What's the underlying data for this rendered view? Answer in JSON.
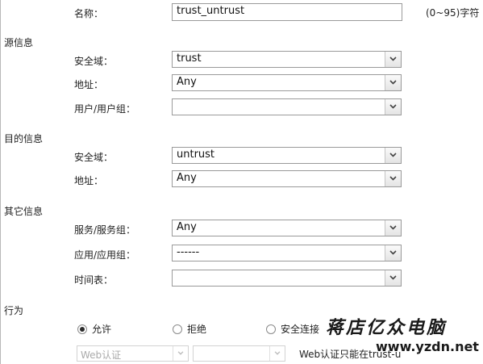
{
  "name_row": {
    "label": "名称：",
    "value": "trust_untrust",
    "hint": "(0~95)字符"
  },
  "source": {
    "title": "源信息",
    "zone": {
      "label": "安全域：",
      "value": "trust"
    },
    "address": {
      "label": "地址：",
      "value": "Any"
    },
    "user": {
      "label": "用户/用户组：",
      "value": ""
    }
  },
  "destination": {
    "title": "目的信息",
    "zone": {
      "label": "安全域：",
      "value": "untrust"
    },
    "address": {
      "label": "地址：",
      "value": "Any"
    }
  },
  "other": {
    "title": "其它信息",
    "service": {
      "label": "服务/服务组：",
      "value": "Any"
    },
    "application": {
      "label": "应用/应用组：",
      "value": "------"
    },
    "schedule": {
      "label": "时间表：",
      "value": ""
    }
  },
  "action": {
    "title": "行为",
    "options": [
      {
        "label": "允许",
        "selected": true
      },
      {
        "label": "拒绝",
        "selected": false
      },
      {
        "label": "安全连接",
        "selected": false
      }
    ],
    "web_auth_select": "Web认证",
    "web_auth_note": "Web认证只能在trust-u"
  },
  "watermark": {
    "text": "蒋店亿众电脑",
    "url": "www.yzdn.net"
  }
}
